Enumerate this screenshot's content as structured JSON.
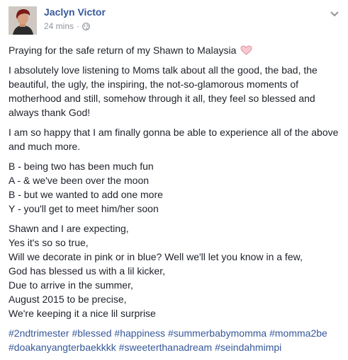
{
  "post": {
    "author": "Jaclyn Victor",
    "timestamp": "24 mins",
    "separator": "·",
    "privacy_icon": "globe-icon",
    "menu_icon": "chevron-down-icon",
    "colors": {
      "link": "#365899",
      "text": "#1d2129",
      "meta": "#90949c",
      "heart": "#f4a3b0"
    }
  },
  "body": {
    "intro": "Praying for the safe return of my Shawn to Malaysia",
    "intro_emoji": "heart-icon",
    "para1": [
      "I absolutely love listening to Moms talk about all the good, the bad, the",
      "beautiful, the ugly, the inspiring, the not-so-glamorous moments of",
      "motherhood and still, somehow through it all, they feel so blessed and",
      "always thank God!"
    ],
    "para2": [
      "I am so happy that I am finally gonna be able to experience all of the above",
      "and much more."
    ],
    "acrostic": [
      "B - being two has been much fun",
      "A - & we've been over the moon",
      "B - but we wanted to add one more",
      "Y - you'll get to meet him/her soon"
    ],
    "poem": [
      "Shawn and I are expecting,",
      "Yes it's so so true,",
      "Will we decorate in pink or in blue? Well we'll let you know in a few,",
      "God has blessed us with a lil kicker,",
      "Due to arrive in the summer,",
      "August 2015 to be precise,",
      "We're keeping it a nice lil surprise"
    ],
    "hashtags_line1": [
      "#2ndtrimester",
      "#blessed",
      "#happiness",
      "#summerbabymomma",
      "#momma2be"
    ],
    "hashtags_line2": [
      "#doakanyangterbaekkkk",
      "#sweeterthanadream",
      "#seindahmimpi"
    ]
  }
}
